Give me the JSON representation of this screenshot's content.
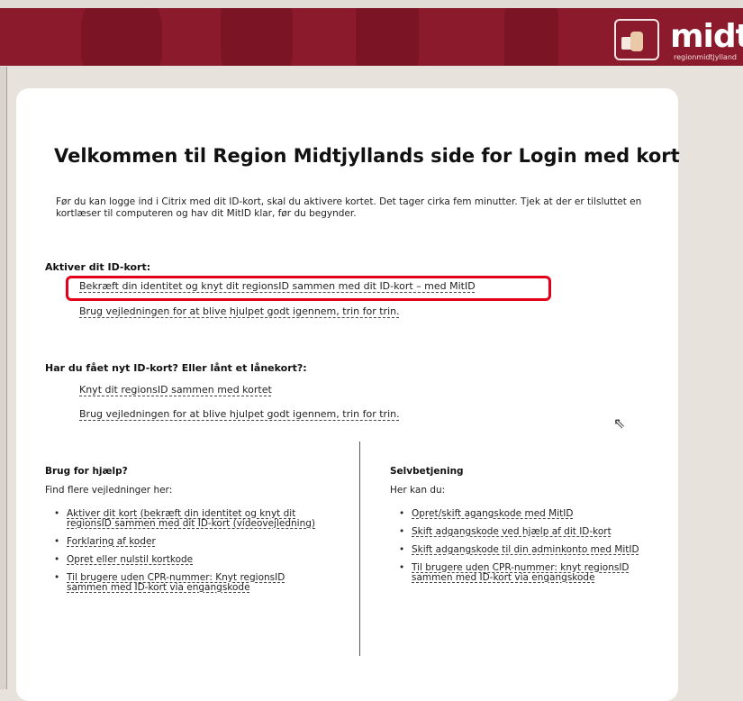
{
  "header": {
    "logo_text": "midt",
    "logo_subtext": "regionmidtjylland"
  },
  "main": {
    "title": "Velkommen til Region Midtjyllands side for Login med kort",
    "intro": "Før du kan logge ind i Citrix med dit ID-kort, skal du aktivere kortet. Det tager cirka fem minutter. Tjek at der er tilsluttet en kortlæser til computeren og hav dit MitID klar, før du begynder.",
    "activate": {
      "heading": "Aktiver dit ID-kort:",
      "links": [
        "Bekræft din identitet og knyt dit regionsID sammen med dit ID-kort – med MitID",
        "Brug vejledningen for at blive hjulpet godt igennem, trin for trin."
      ]
    },
    "newcard": {
      "heading": "Har du fået nyt ID-kort? Eller lånt et lånekort?:",
      "links": [
        "Knyt dit regionsID sammen med kortet",
        "Brug vejledningen for at blive hjulpet godt igennem, trin for trin."
      ]
    },
    "help": {
      "heading": "Brug for hjælp?",
      "subtext": "Find flere vejledninger her:",
      "items": [
        "Aktiver dit kort (bekræft din identitet og knyt dit regionsID sammen med dit ID-kort (videovejledning)",
        "Forklaring af koder",
        "Opret eller nulstil kortkode",
        "Til brugere uden CPR-nummer: Knyt regionsID sammen med ID-kort via engangskode"
      ]
    },
    "selfservice": {
      "heading": "Selvbetjening",
      "subtext": "Her kan du:",
      "items": [
        "Opret/skift agangskode med MitID",
        "Skift adgangskode ved hjælp af dit ID-kort",
        "Skift adgangskode til din adminkonto med MitID",
        "Til brugere uden CPR-nummer: knyt regionsID sammen med ID-kort via engangskode"
      ]
    }
  },
  "colors": {
    "header_bg": "#8b1a2c",
    "highlight": "#e3001b"
  }
}
